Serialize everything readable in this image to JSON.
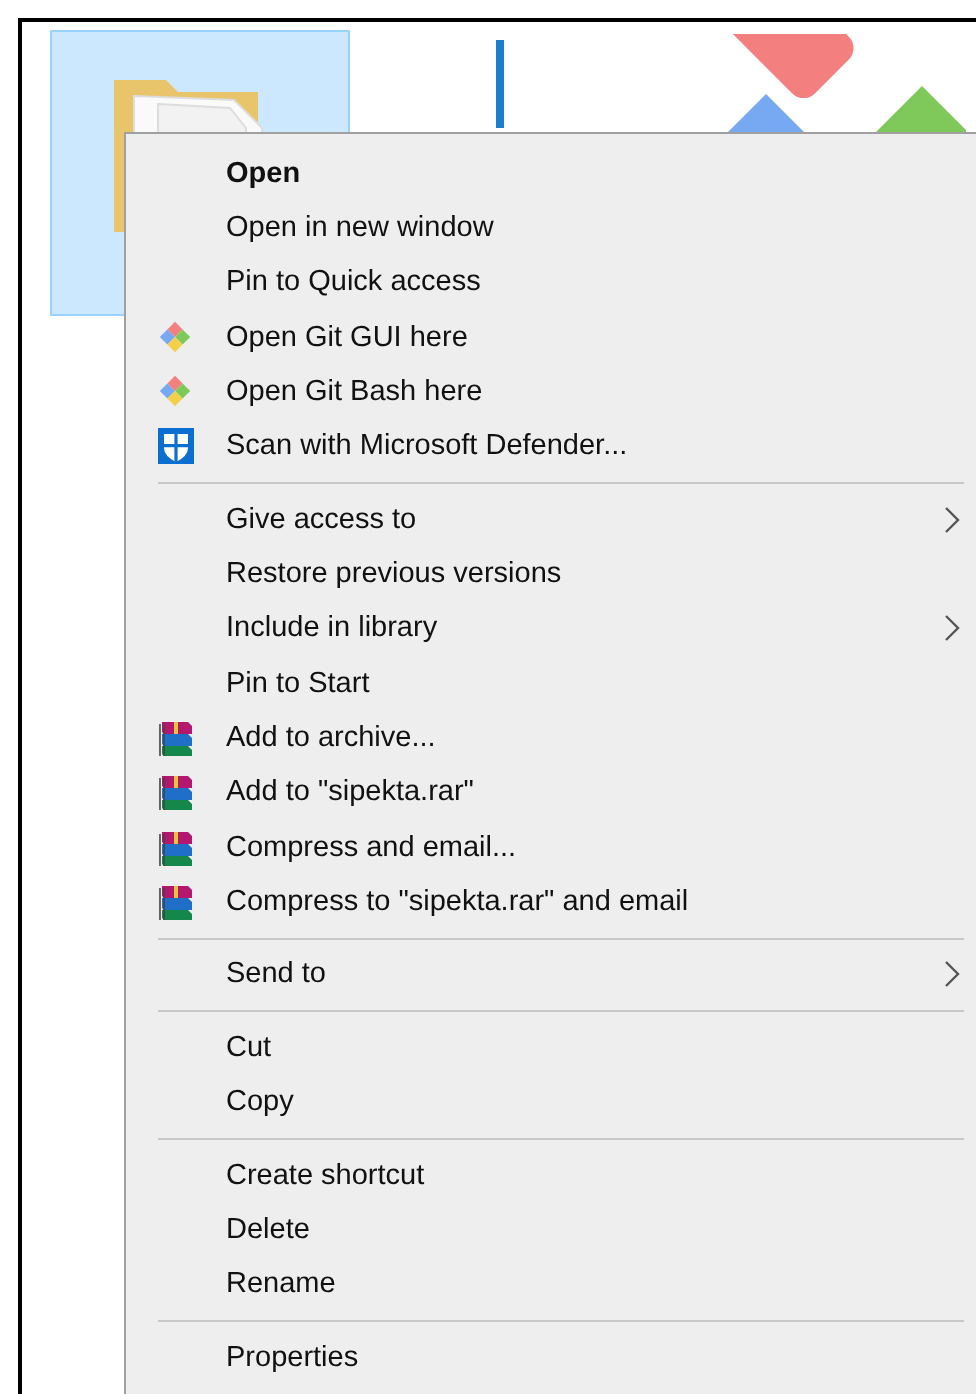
{
  "folder_tile": {
    "selected": true
  },
  "context_menu": {
    "items": [
      {
        "kind": "item",
        "label": "Open",
        "default": true
      },
      {
        "kind": "item",
        "label": "Open in new window",
        "default": false
      },
      {
        "kind": "item",
        "label": "Pin to Quick access",
        "default": false
      },
      {
        "kind": "git-item",
        "label": "Open Git GUI here",
        "default": false
      },
      {
        "kind": "git-item",
        "label": "Open Git Bash here",
        "default": false
      },
      {
        "kind": "shield-item",
        "label": "Scan with Microsoft Defender...",
        "default": false
      },
      {
        "kind": "separator"
      },
      {
        "kind": "submenu",
        "label": "Give access to",
        "default": false
      },
      {
        "kind": "item",
        "label": "Restore previous versions",
        "default": false
      },
      {
        "kind": "submenu",
        "label": "Include in library",
        "default": false
      },
      {
        "kind": "item",
        "label": "Pin to Start",
        "default": false
      },
      {
        "kind": "archive-item",
        "label": "Add to archive...",
        "default": false
      },
      {
        "kind": "archive-item",
        "label": "Add to \"sipekta.rar\"",
        "default": false
      },
      {
        "kind": "archive-item",
        "label": "Compress and email...",
        "default": false
      },
      {
        "kind": "archive-item",
        "label": "Compress to \"sipekta.rar\" and email",
        "default": false
      },
      {
        "kind": "separator"
      },
      {
        "kind": "submenu",
        "label": "Send to",
        "default": false
      },
      {
        "kind": "separator"
      },
      {
        "kind": "item",
        "label": "Cut",
        "default": false
      },
      {
        "kind": "item",
        "label": "Copy",
        "default": false
      },
      {
        "kind": "separator"
      },
      {
        "kind": "item",
        "label": "Create shortcut",
        "default": false
      },
      {
        "kind": "item",
        "label": "Delete",
        "default": false
      },
      {
        "kind": "item",
        "label": "Rename",
        "default": false
      },
      {
        "kind": "separator"
      },
      {
        "kind": "item",
        "label": "Properties",
        "default": false
      }
    ]
  }
}
